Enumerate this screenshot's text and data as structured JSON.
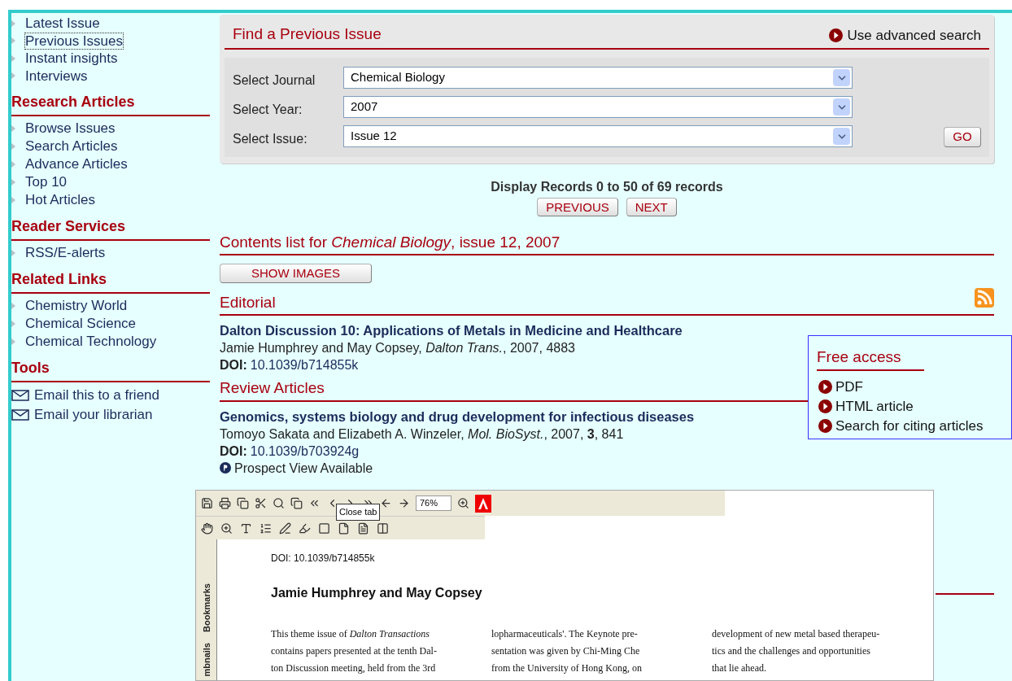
{
  "sidebar": {
    "top_links": [
      {
        "label": "Latest Issue",
        "selected": false
      },
      {
        "label": "Previous Issues",
        "selected": true
      },
      {
        "label": "Instant insights",
        "selected": false
      },
      {
        "label": "Interviews",
        "selected": false
      }
    ],
    "sections": [
      {
        "title": "Research Articles",
        "kind": "links",
        "items": [
          "Browse Issues",
          "Search Articles",
          "Advance Articles",
          "Top 10",
          "Hot Articles"
        ]
      },
      {
        "title": "Reader Services",
        "kind": "links",
        "items": [
          "RSS/E-alerts"
        ]
      },
      {
        "title": "Related Links",
        "kind": "links",
        "items": [
          "Chemistry World",
          "Chemical Science",
          "Chemical Technology"
        ]
      },
      {
        "title": "Tools",
        "kind": "email",
        "items": [
          "Email this to a friend",
          "Email your librarian"
        ]
      }
    ]
  },
  "search_panel": {
    "title": "Find a Previous Issue",
    "advanced_link": "Use advanced search",
    "fields": [
      {
        "label": "Select Journal",
        "value": "Chemical Biology"
      },
      {
        "label": "Select Year:",
        "value": "2007"
      },
      {
        "label": "Select Issue:",
        "value": "Issue 12"
      }
    ],
    "go_button": "GO"
  },
  "records": {
    "summary": "Display Records 0 to 50 of 69 records",
    "buttons": [
      "PREVIOUS",
      "NEXT"
    ]
  },
  "contents_title": "Contents list for *Chemical Biology*, issue 12, 2007",
  "show_images_button": "SHOW IMAGES",
  "sections": [
    {
      "title": "Editorial",
      "rss": true,
      "articles": [
        {
          "title": "Dalton Discussion 10: Applications of Metals in Medicine and Healthcare",
          "citation": "Jamie Humphrey and May Copsey,  *Dalton Trans.*, 2007, 4883",
          "doi_label": "DOI:",
          "doi": "10.1039/b714855k"
        }
      ]
    },
    {
      "title": "Review Articles",
      "rss": false,
      "articles": [
        {
          "title": "Genomics, systems biology and drug development for infectious diseases",
          "citation": "Tomoyo Sakata and Elizabeth A. Winzeler,  *Mol. BioSyst.*, 2007, **3**, 841",
          "doi_label": "DOI:",
          "doi": "10.1039/b703924g",
          "prospect": "Prospect View Available"
        }
      ]
    }
  ],
  "free_access": {
    "title": "Free access",
    "links": [
      "PDF",
      "HTML article",
      "Search for citing articles"
    ]
  },
  "pdf_viewer": {
    "tooltip": "Close tab",
    "zoom": "76%",
    "side_tabs": [
      "Bookmarks",
      "mbnails"
    ],
    "doi": "DOI: 10.1039/b714855k",
    "authors": "Jamie Humphrey and May Copsey",
    "columns": [
      "This theme issue of *Dalton Transactions*\ncontains papers presented at the tenth Dal-\nton Discussion meeting, held from the 3rd",
      "lopharmaceuticals'. The Keynote pre-\nsentation was given by Chi-Ming Che\nfrom the University of Hong Kong, on",
      "development of new metal based therapeu-\ntics and the challenges and opportunities\nthat lie ahead."
    ]
  }
}
